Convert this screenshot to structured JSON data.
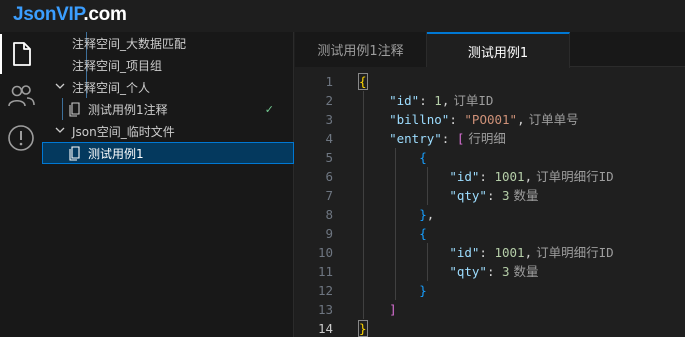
{
  "app": {
    "logo_main": "JsonVIP",
    "logo_suffix": ".com"
  },
  "activity_bar": {
    "items": [
      {
        "icon": "file-icon",
        "active": true
      },
      {
        "icon": "users-icon",
        "active": false
      },
      {
        "icon": "alert-icon",
        "active": false
      }
    ]
  },
  "explorer": {
    "rows": [
      {
        "label": "注释空间_大数据匹配",
        "type": "folder-item"
      },
      {
        "label": "注释空间_项目组",
        "type": "folder-item"
      },
      {
        "label": "注释空间_个人",
        "type": "folder",
        "expanded": true
      },
      {
        "label": "测试用例1注释",
        "type": "file",
        "status": "✓"
      },
      {
        "label": "Json空间_临时文件",
        "type": "folder",
        "expanded": true
      },
      {
        "label": "测试用例1",
        "type": "file",
        "selected": true
      }
    ]
  },
  "tabs": [
    {
      "label": "测试用例1注释",
      "active": false
    },
    {
      "label": "测试用例1",
      "active": true
    }
  ],
  "editor": {
    "current_line": 14,
    "lines": [
      {
        "n": "1"
      },
      {
        "n": "2",
        "key": "\"id\"",
        "value": "1",
        "hint": "订单ID"
      },
      {
        "n": "3",
        "key": "\"billno\"",
        "value": "\"PO001\"",
        "hint": "订单单号"
      },
      {
        "n": "4",
        "key": "\"entry\"",
        "hint": "行明细"
      },
      {
        "n": "5"
      },
      {
        "n": "6",
        "key": "\"id\"",
        "value": "1001",
        "hint": "订单明细行ID"
      },
      {
        "n": "7",
        "key": "\"qty\"",
        "value": "3",
        "hint": "数量"
      },
      {
        "n": "8"
      },
      {
        "n": "9"
      },
      {
        "n": "10",
        "key": "\"id\"",
        "value": "1001",
        "hint": "订单明细行ID"
      },
      {
        "n": "11",
        "key": "\"qty\"",
        "value": "3",
        "hint": "数量"
      },
      {
        "n": "12"
      },
      {
        "n": "13"
      },
      {
        "n": "14"
      }
    ]
  }
}
